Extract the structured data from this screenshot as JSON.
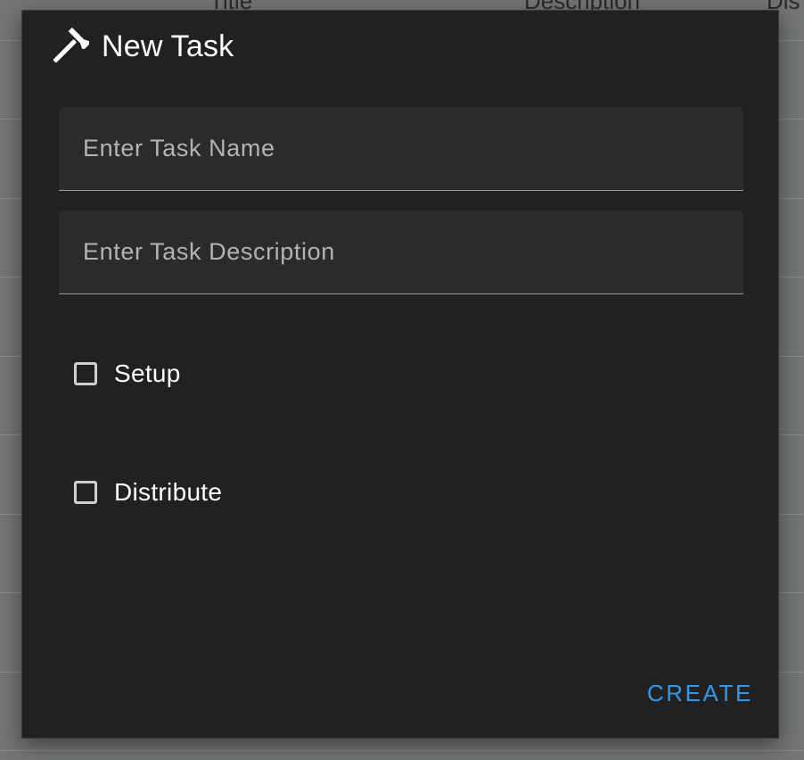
{
  "background_table": {
    "headers": [
      "Title",
      "Description",
      "Dis"
    ]
  },
  "dialog": {
    "icon": "hammer-icon",
    "title": "New Task",
    "fields": {
      "task_name": {
        "value": "",
        "placeholder": "Enter Task Name"
      },
      "task_description": {
        "value": "",
        "placeholder": "Enter Task Description"
      }
    },
    "checkboxes": [
      {
        "label": "Setup",
        "checked": false
      },
      {
        "label": "Distribute",
        "checked": false
      }
    ],
    "actions": {
      "create_label": "CREATE"
    }
  },
  "colors": {
    "dialog_bg": "#212121",
    "field_bg": "#2b2b2b",
    "accent": "#2d9bf0",
    "backdrop": "#737674"
  }
}
